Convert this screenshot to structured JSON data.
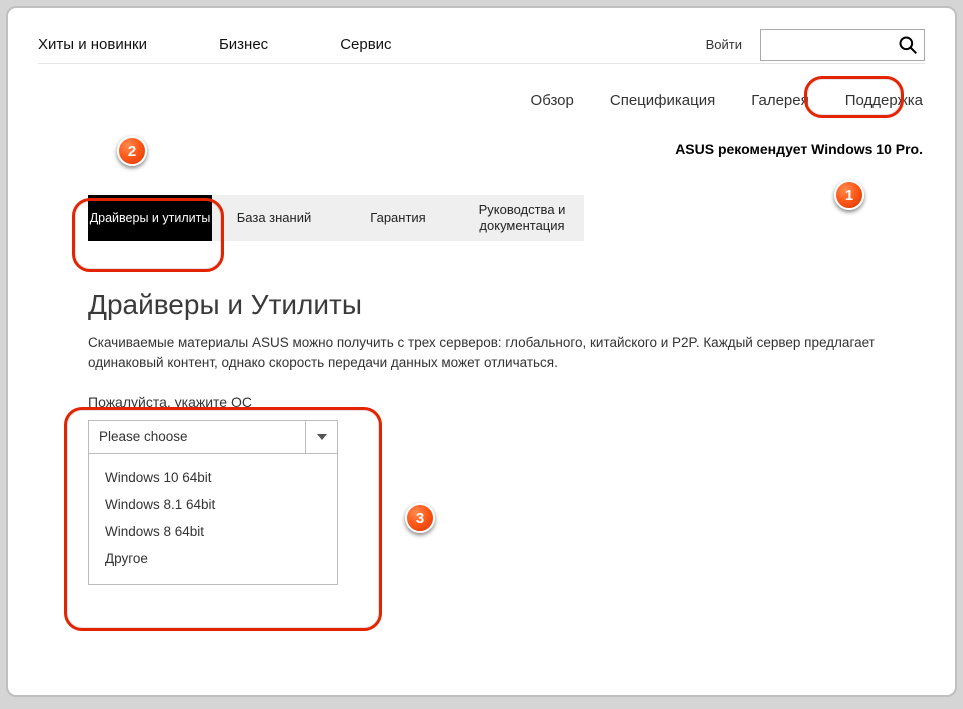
{
  "topnav": {
    "items": [
      "Хиты и новинки",
      "Бизнес",
      "Сервис"
    ],
    "login": "Войти",
    "search_placeholder": ""
  },
  "subnav": {
    "items": [
      "Обзор",
      "Спецификация",
      "Галерея",
      "Поддержка"
    ]
  },
  "recommend": "ASUS рекомендует Windows 10 Pro.",
  "tabs": {
    "items": [
      "Драйверы и утилиты",
      "База знаний",
      "Гарантия",
      "Руководства и документация"
    ]
  },
  "section": {
    "title": "Драйверы и Утилиты",
    "desc": "Скачиваемые материалы ASUS можно получить с трех серверов: глобального, китайского и P2P. Каждый сервер предлагает одинаковый контент, однако скорость передачи данных может отличаться."
  },
  "os": {
    "label": "Пожалуйста, укажите ОС",
    "placeholder": "Please choose",
    "options": [
      "Windows 10 64bit",
      "Windows 8.1 64bit",
      "Windows 8 64bit",
      "Другое"
    ]
  },
  "badges": {
    "b1": "1",
    "b2": "2",
    "b3": "3"
  }
}
